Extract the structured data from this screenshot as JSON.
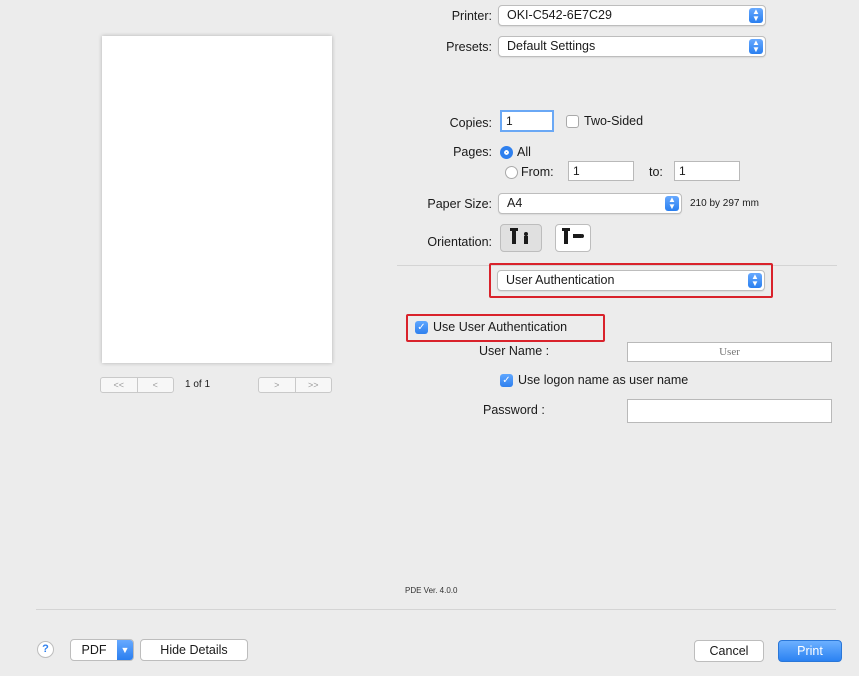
{
  "preview": {
    "page_indicator": "1 of 1",
    "nav_first": "<<",
    "nav_prev": "<",
    "nav_next": ">",
    "nav_last": ">>"
  },
  "printer": {
    "label": "Printer:",
    "value": "OKI-C542-6E7C29"
  },
  "presets": {
    "label": "Presets:",
    "value": "Default Settings"
  },
  "copies": {
    "label": "Copies:",
    "value": "1",
    "two_sided_label": "Two-Sided",
    "two_sided_checked": false
  },
  "pages": {
    "label": "Pages:",
    "all_label": "All",
    "from_label": "From:",
    "from_value": "1",
    "to_label": "to:",
    "to_value": "1"
  },
  "paper_size": {
    "label": "Paper Size:",
    "value": "A4",
    "dimensions": "210 by 297 mm"
  },
  "orientation": {
    "label": "Orientation:",
    "portrait_icon": "portrait-orientation-icon",
    "landscape_icon": "landscape-orientation-icon"
  },
  "section_select": {
    "value": "User Authentication"
  },
  "auth": {
    "use_auth_label": "Use User Authentication",
    "use_auth_checked": true,
    "user_name_label": "User Name :",
    "user_name_placeholder": "User",
    "use_logon_label": "Use logon name as user name",
    "use_logon_checked": true,
    "password_label": "Password :",
    "password_value": ""
  },
  "pde_version": "PDE Ver. 4.0.0",
  "footer": {
    "help_label": "?",
    "pdf_label": "PDF",
    "hide_details_label": "Hide Details",
    "cancel_label": "Cancel",
    "print_label": "Print"
  },
  "colors": {
    "accent": "#2f80ee",
    "highlight_border": "#d9222b",
    "dialog_bg": "#ececec"
  }
}
